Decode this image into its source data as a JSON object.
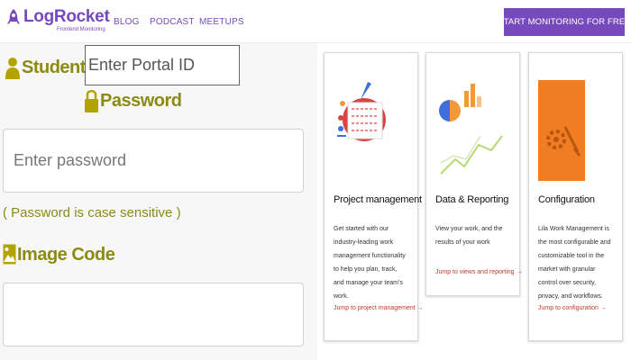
{
  "header": {
    "brand": "LogRocket",
    "tagline": "Frontend Monitoring",
    "nav": [
      "BLOG",
      "PODCAST",
      "MEETUPS"
    ],
    "cta": "START MONITORING FOR FREE",
    "brand_color": "#764abc"
  },
  "form": {
    "student_id_label": "Student ID",
    "student_id_placeholder": "Enter Portal ID",
    "password_label": "Password",
    "password_placeholder": "Enter password",
    "password_hint": "( Password is case sensitive )",
    "image_code_label": "Image Code",
    "image_code_value": "",
    "label_color": "#8b8b14",
    "icons": [
      "user-icon",
      "lock-icon",
      "image-icon"
    ]
  },
  "cards": [
    {
      "title": "Project management",
      "text": "Get started with our industry-leading work management functionality to help you plan, track, and manage your team's work.",
      "link": "Jump to project management →",
      "icon": "gear-flowchart-icon"
    },
    {
      "title": "Data & Reporting",
      "text": "View your work, and the results of your work",
      "link": "Jump to views and reporting →",
      "icon": "charts-icon"
    },
    {
      "title": "Configuration",
      "text": "Lila Work Management is the most configurable and customizable tool in the market with granular control over security, privacy, and workflows.",
      "link": "Jump to configuration →",
      "icon": "settings-tools-icon"
    }
  ]
}
